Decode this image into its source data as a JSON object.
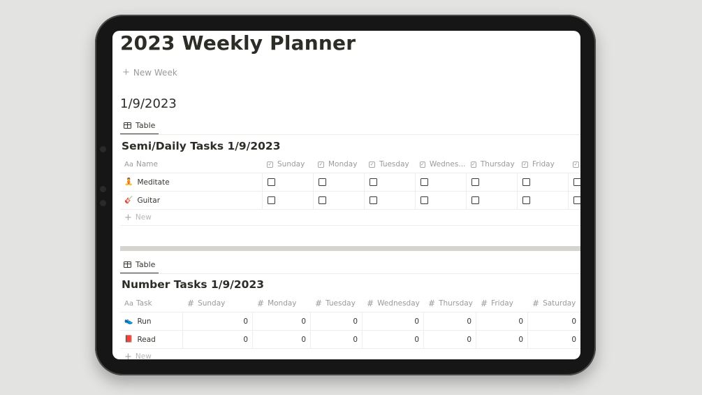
{
  "page": {
    "title": "2023 Weekly Planner",
    "new_week_label": "New Week",
    "week_heading": "1/9/2023"
  },
  "daily_db": {
    "view_tab_label": "Table",
    "title": "Semi/Daily Tasks 1/9/2023",
    "name_column": {
      "prefix": "Aa",
      "label": "Name"
    },
    "columns": [
      "Sunday",
      "Monday",
      "Tuesday",
      "Wednes...",
      "Thursday",
      "Friday",
      ""
    ],
    "rows": [
      {
        "emoji": "🧘",
        "name": "Meditate",
        "checked": [
          false,
          false,
          false,
          false,
          false,
          false,
          false
        ]
      },
      {
        "emoji": "🎸",
        "name": "Guitar",
        "checked": [
          false,
          false,
          false,
          false,
          false,
          false,
          false
        ]
      }
    ],
    "new_label": "New"
  },
  "number_db": {
    "view_tab_label": "Table",
    "title": "Number Tasks 1/9/2023",
    "name_column": {
      "prefix": "Aa",
      "label": "Task"
    },
    "columns": [
      "Sunday",
      "Monday",
      "Tuesday",
      "Wednesday",
      "Thursday",
      "Friday",
      "Saturday"
    ],
    "rows": [
      {
        "emoji": "👟",
        "name": "Run",
        "values": [
          "0",
          "0",
          "0",
          "0",
          "0",
          "0",
          "0"
        ]
      },
      {
        "emoji": "📕",
        "name": "Read",
        "values": [
          "0",
          "0",
          "0",
          "0",
          "0",
          "0",
          "0"
        ]
      }
    ],
    "new_label": "New"
  }
}
